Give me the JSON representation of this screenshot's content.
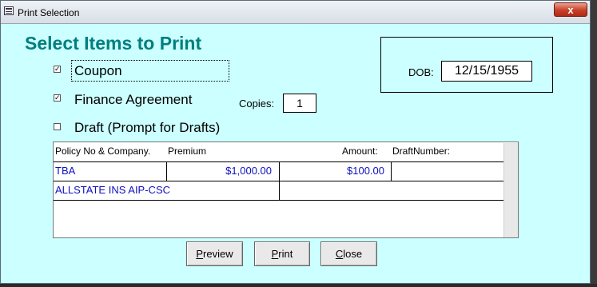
{
  "window": {
    "title": "Print Selection",
    "close_label": "x"
  },
  "heading": "Select Items to Print",
  "options": [
    {
      "label": "Coupon",
      "checked": true
    },
    {
      "label": "Finance Agreement",
      "checked": true
    },
    {
      "label": "Draft (Prompt for Drafts)",
      "checked": false
    }
  ],
  "copies": {
    "label": "Copies:",
    "value": "1"
  },
  "dob": {
    "label": "DOB:",
    "value": "12/15/1955"
  },
  "table": {
    "headers": [
      "Policy No & Company.",
      "Premium",
      "Amount:",
      "DraftNumber:"
    ],
    "rows": [
      {
        "policy": "TBA",
        "premium": "$1,000.00",
        "amount": "$100.00",
        "draft": ""
      },
      {
        "company": "ALLSTATE INS AIP-CSC"
      }
    ]
  },
  "buttons": {
    "preview": {
      "mnemonic": "P",
      "rest": "review"
    },
    "print": {
      "mnemonic": "P",
      "rest": "rint"
    },
    "close": {
      "mnemonic": "C",
      "rest": "lose"
    }
  }
}
